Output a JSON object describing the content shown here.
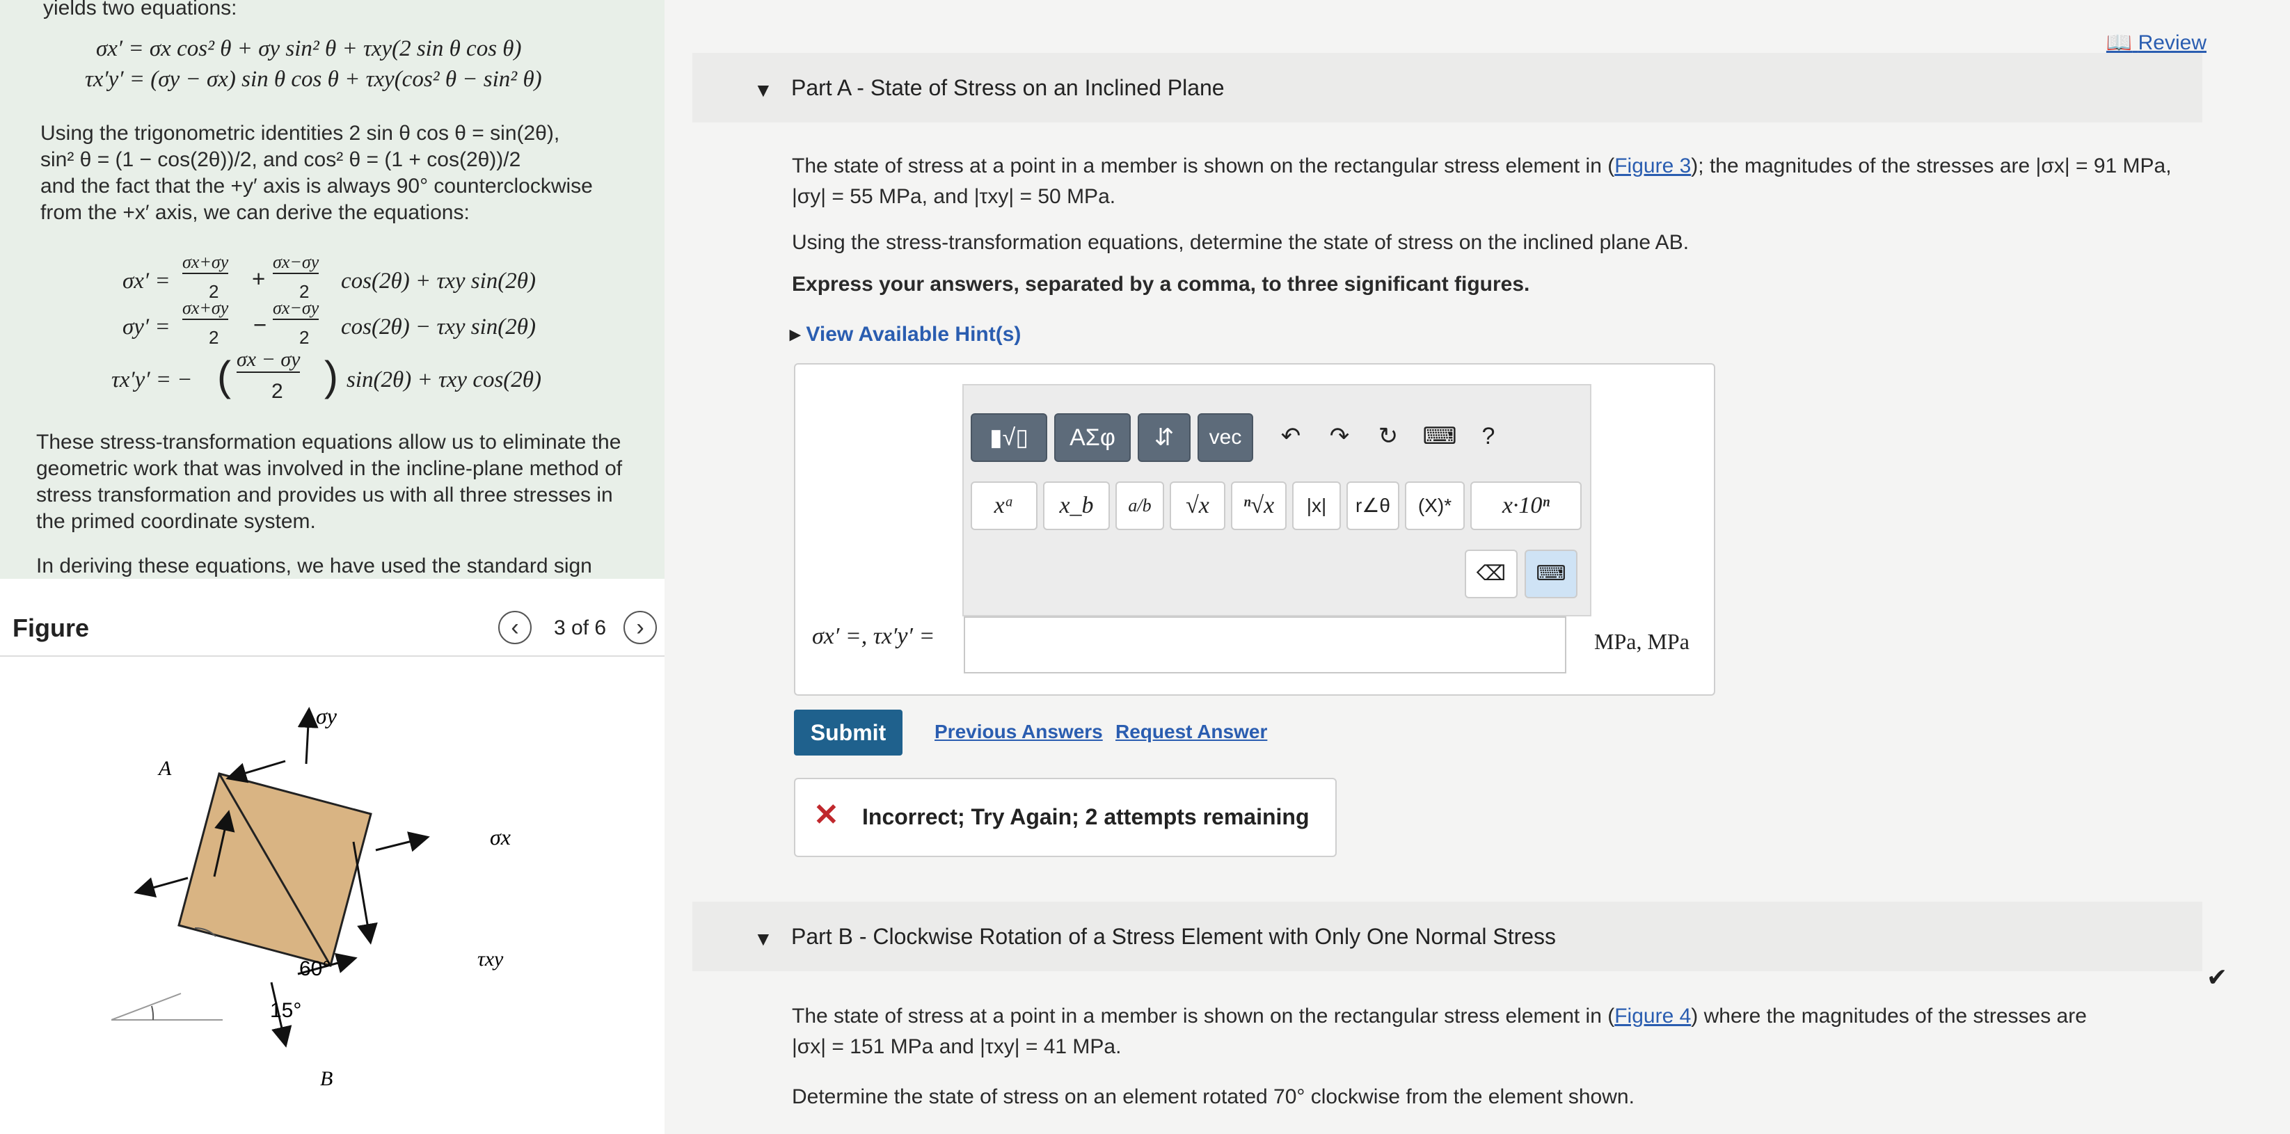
{
  "left": {
    "top_cut": "yields two equations:",
    "eq1": "σx′ = σx cos² θ + σy sin² θ + τxy(2 sin θ cos θ)",
    "eq2": "τx′y′ = (σy − σx) sin θ cos θ + τxy(cos² θ − sin² θ)",
    "para1_l1": "Using the trigonometric identities 2 sin θ cos θ = sin(2θ),",
    "para1_l2": "sin² θ = (1 − cos(2θ))/2, and cos² θ = (1 + cos(2θ))/2",
    "para1_l3": "and the fact that the +y′ axis is always 90° counterclockwise",
    "para1_l4": "from the +x′ axis, we can derive the equations:",
    "t_eq1_lhs": "σx′ =",
    "t_eq1_rhs": "cos(2θ) + τxy sin(2θ)",
    "t_eq2_lhs": "σy′ =",
    "t_eq2_rhs": "cos(2θ) − τxy sin(2θ)",
    "t_eq3_lhs": "τx′y′ = −",
    "t_eq3_rhs": "sin(2θ) + τxy cos(2θ)",
    "frac_num_sum": "σx+σy",
    "frac_num_diff": "σx−σy",
    "frac_num_diff2": "σx − σy",
    "frac_den": "2",
    "para2_l1": "These stress-transformation equations allow us to eliminate the",
    "para2_l2": "geometric work that was involved in the incline-plane method of",
    "para2_l3": "stress transformation and provides us with all three stresses in",
    "para2_l4": "the primed coordinate system.",
    "para3_l1": "In deriving these equations, we have used the standard sign"
  },
  "figure": {
    "title": "Figure",
    "count": "3 of 6",
    "prev_icon": "chevron-left-icon",
    "next_icon": "chevron-right-icon",
    "label_A": "A",
    "label_B": "B",
    "label_sigma_y": "σy",
    "label_sigma_x": "σx",
    "label_tau_xy": "τxy",
    "angle_60": "60°",
    "angle_15": "15°",
    "block_color": "#d9b483"
  },
  "right": {
    "review": "Review",
    "partA": {
      "title": "Part A - State of Stress on an Inclined Plane",
      "p1_l1_a": "The state of stress at a point in a member is shown on the rectangular stress element in (",
      "p1_link": "Figure 3",
      "p1_l1_b": "); the magnitudes of the stresses are |σx| = 91 MPa,",
      "p1_l2": "|σy| = 55 MPa, and |τxy| = 50 MPa.",
      "p2": "Using the stress-transformation equations, determine the state of stress on the inclined plane AB.",
      "p3": "Express your answers, separated by a comma, to three significant figures.",
      "hints": "View Available Hint(s)",
      "toolbar": {
        "b1": "▮√▯",
        "b2": "ΑΣφ",
        "b3": "⇵",
        "b4": "vec",
        "undo": "↶",
        "redo": "↷",
        "reset": "↻",
        "keyboard": "⌨",
        "help": "?",
        "r2": [
          "xᵃ",
          "x_b",
          "a/b",
          "√x",
          "ⁿ√x",
          "|x|",
          "r∠θ",
          "(X)*",
          "x·10ⁿ"
        ],
        "backspace": "⌫",
        "kb2": "⌨"
      },
      "answer_label": "σx′ =, τx′y′ =",
      "answer_value": "",
      "answer_unit": "MPa, MPa",
      "submit": "Submit",
      "previous_answers": "Previous Answers",
      "request_answer": "Request Answer",
      "feedback": "Incorrect; Try Again; 2 attempts remaining",
      "feedback_color": "#c0282d"
    },
    "partB": {
      "title": "Part B - Clockwise Rotation of a Stress Element with Only One Normal Stress",
      "p1_l1_a": "The state of stress at a point in a member is shown on the rectangular stress element in (",
      "p1_link": "Figure 4",
      "p1_l1_b": ") where the magnitudes of the stresses are",
      "p1_l2": "|σx| = 151 MPa and |τxy| = 41 MPa.",
      "p2": "Determine the state of stress on an element rotated 70° clockwise from the element shown.",
      "check": "✔"
    }
  }
}
